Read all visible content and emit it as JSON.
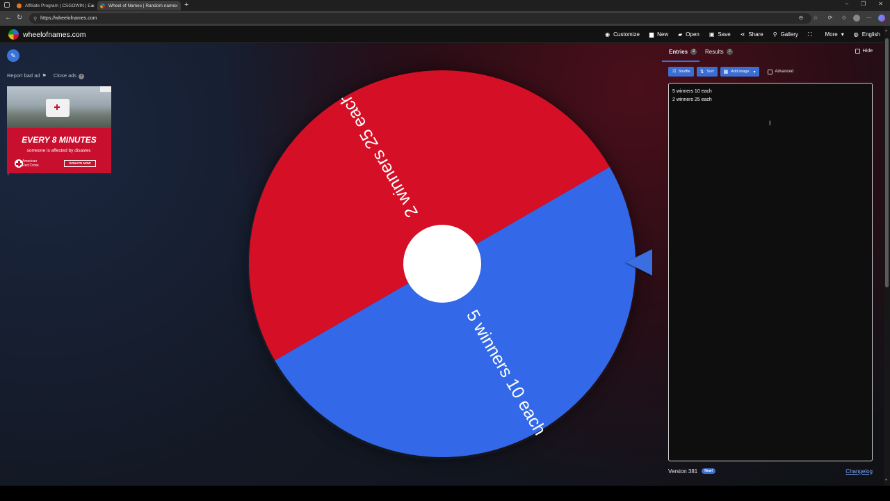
{
  "browser": {
    "tabs": [
      {
        "title": "Affiliate Program | CSGOWIN | Ea"
      },
      {
        "title": "Wheel of Names | Random name"
      }
    ],
    "url": "https://wheelofnames.com",
    "new_tab_glyph": "+",
    "colors": {
      "active_tab_bg": "#3c3c3c",
      "chrome_bg": "#1f1f1f"
    }
  },
  "header": {
    "site_title": "wheelofnames.com",
    "nav": [
      {
        "label": "Customize",
        "icon": "palette-icon"
      },
      {
        "label": "New",
        "icon": "file-icon"
      },
      {
        "label": "Open",
        "icon": "folder-icon"
      },
      {
        "label": "Save",
        "icon": "save-icon"
      },
      {
        "label": "Share",
        "icon": "share-icon"
      },
      {
        "label": "Gallery",
        "icon": "search-icon"
      },
      {
        "label": "",
        "icon": "fullscreen-icon"
      },
      {
        "label": "More",
        "icon": "chevron-down-icon"
      },
      {
        "label": "English",
        "icon": "globe-icon"
      }
    ]
  },
  "ads": {
    "report_label": "Report bad ad",
    "close_label": "Close ads",
    "headline": "EVERY 8 MINUTES",
    "subline": "someone is affected by disaster.",
    "org": "American Red Cross",
    "cta": "DONATE NOW",
    "info": "?"
  },
  "wheel": {
    "segments": [
      {
        "label": "5 winners 10 each",
        "color": "#3369e8",
        "start_deg": -30,
        "end_deg": 150
      },
      {
        "label": "2 winners 25 each",
        "color": "#d50f25",
        "start_deg": 150,
        "end_deg": 330
      }
    ],
    "pointer_color": "#3b6ee0",
    "hub_color": "#ffffff"
  },
  "panel": {
    "tabs": [
      {
        "label": "Entries",
        "count": "2"
      },
      {
        "label": "Results",
        "count": "2"
      }
    ],
    "hide_label": "Hide",
    "toolbar": {
      "shuffle_label": "Shuffle",
      "sort_label": "Sort",
      "add_image_label": "Add image",
      "advanced_label": "Advanced"
    },
    "entries": [
      "5 winners 10 each",
      "2 winners 25 each"
    ],
    "version_label": "Version 381",
    "new_badge": "New!",
    "changelog_label": "Changelog",
    "accent_color": "#3b73d9"
  }
}
